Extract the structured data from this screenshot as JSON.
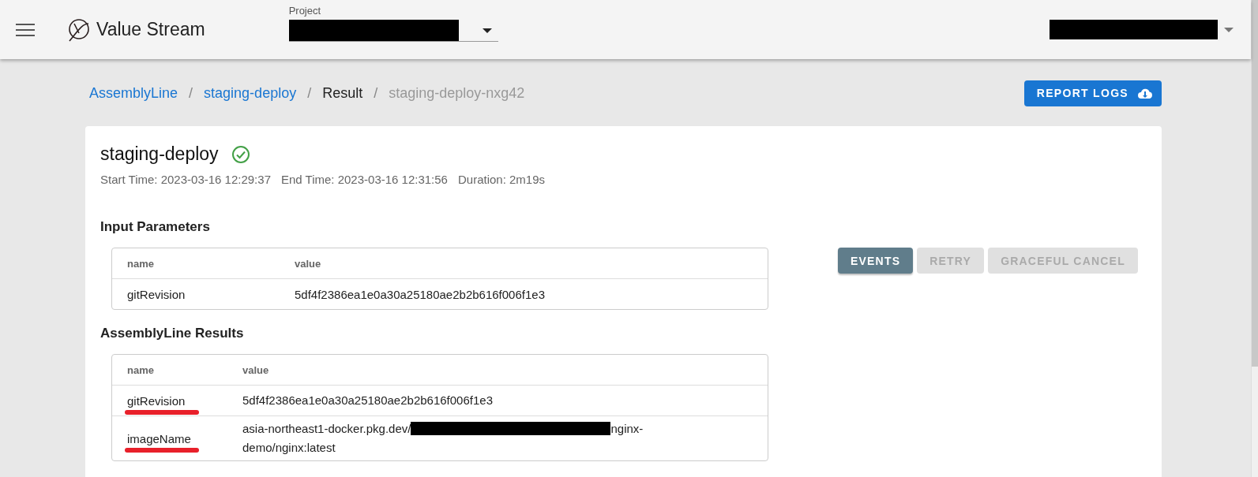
{
  "app_bar": {
    "app_name": "Value Stream",
    "project_selector": {
      "label": "Project",
      "redacted": true
    },
    "user_menu": {
      "redacted": true
    }
  },
  "breadcrumb_separator": "/",
  "breadcrumbs": [
    {
      "label": "AssemblyLine",
      "kind": "link"
    },
    {
      "label": "staging-deploy",
      "kind": "link"
    },
    {
      "label": "Result",
      "kind": "current"
    },
    {
      "label": "staging-deploy-nxg42",
      "kind": "muted"
    }
  ],
  "report_button": "REPORT LOGS",
  "run": {
    "title": "staging-deploy",
    "succeeded": true,
    "times": [
      {
        "label": "Start Time:",
        "value": "2023-03-16 12:29:37"
      },
      {
        "label": "End Time:",
        "value": "2023-03-16 12:31:56"
      },
      {
        "label": "Duration:",
        "value": "2m19s"
      }
    ]
  },
  "input_parameters": {
    "heading": "Input Parameters",
    "columns": [
      "name",
      "value"
    ],
    "rows": [
      {
        "name": "gitRevision",
        "value": [
          {
            "text": "5df4f2386ea1e0a30a25180ae2b2b616f006f1e3"
          }
        ]
      }
    ]
  },
  "actions": [
    {
      "label": "EVENTS",
      "disabled": false
    },
    {
      "label": "RETRY",
      "disabled": true
    },
    {
      "label": "GRACEFUL CANCEL",
      "disabled": true
    }
  ],
  "results": {
    "heading": "AssemblyLine Results",
    "columns": [
      "name",
      "value"
    ],
    "rows": [
      {
        "name": "gitRevision",
        "value": [
          {
            "text": "5df4f2386ea1e0a30a25180ae2b2b616f006f1e3"
          }
        ],
        "underlined": true
      },
      {
        "name": "imageName",
        "value": [
          {
            "text": "asia-northeast1-docker.pkg.dev/"
          },
          {
            "redacted": true
          },
          {
            "text": "nginx-demo/nginx:latest"
          }
        ],
        "underlined": true
      }
    ]
  }
}
